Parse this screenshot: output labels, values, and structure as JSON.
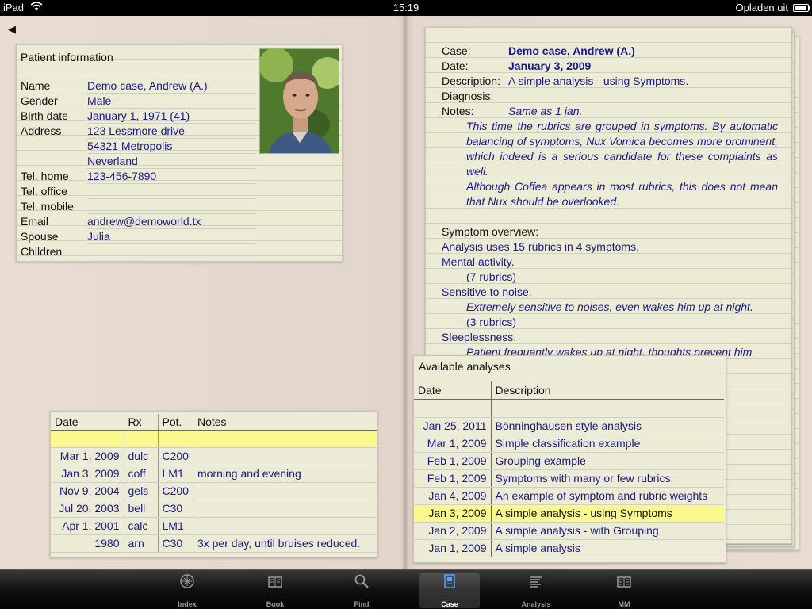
{
  "status": {
    "device": "iPad",
    "time": "15:19",
    "battery_text": "Opladen uit"
  },
  "patient": {
    "heading": "Patient information",
    "fields": [
      {
        "label": "Name",
        "value": "Demo case, Andrew (A.)"
      },
      {
        "label": "Gender",
        "value": "Male"
      },
      {
        "label": "Birth date",
        "value": "January 1, 1971 (41)"
      },
      {
        "label": "Address",
        "value": "123 Lessmore drive"
      },
      {
        "label": "",
        "value": "54321  Metropolis"
      },
      {
        "label": "",
        "value": "Neverland"
      },
      {
        "label": "Tel. home",
        "value": "123-456-7890"
      },
      {
        "label": "Tel. office",
        "value": ""
      },
      {
        "label": "Tel. mobile",
        "value": ""
      },
      {
        "label": "Email",
        "value": "andrew@demoworld.tx"
      },
      {
        "label": "Spouse",
        "value": "Julia"
      },
      {
        "label": "Children",
        "value": ""
      }
    ]
  },
  "prescriptions": {
    "headers": [
      "Date",
      "Rx",
      "Pot.",
      "Notes"
    ],
    "rows": [
      {
        "date": "Mar 1, 2009",
        "rx": "dulc",
        "pot": "C200",
        "notes": ""
      },
      {
        "date": "Jan 3, 2009",
        "rx": "coff",
        "pot": "LM1",
        "notes": "morning and evening"
      },
      {
        "date": "Nov 9, 2004",
        "rx": "gels",
        "pot": "C200",
        "notes": ""
      },
      {
        "date": "Jul 20, 2003",
        "rx": "bell",
        "pot": "C30",
        "notes": ""
      },
      {
        "date": "Apr 1, 2001",
        "rx": "calc",
        "pot": "LM1",
        "notes": ""
      },
      {
        "date": "1980",
        "rx": "arn",
        "pot": "C30",
        "notes": "3x per day, until bruises reduced."
      }
    ]
  },
  "case": {
    "case_label": "Case:",
    "case_value": "Demo case, Andrew (A.)",
    "date_label": "Date:",
    "date_value": "January 3, 2009",
    "desc_label": "Description:",
    "desc_value": "A simple analysis - using Symptoms.",
    "diag_label": "Diagnosis:",
    "notes_label": "Notes:",
    "notes_first": "Same as 1 jan.",
    "notes_para1": "This time the rubrics are grouped in symptoms. By automatic balancing of symptoms, Nux Vomica becomes more prominent, which indeed is a serious candidate for these complaints as well.",
    "notes_para2": "Although Coffea appears in most rubrics, this does not mean that Nux should be overlooked.",
    "overview_label": "Symptom overview:",
    "overview_summary": "Analysis uses 15 rubrics in 4 symptoms.",
    "s1": "Mental activity.",
    "s1_count": "(7 rubrics)",
    "s2": "Sensitive to noise.",
    "s2_note": "Extremely sensitive to noises, even wakes him up at night.",
    "s2_count": "(3 rubrics)",
    "s3": "Sleeplessness.",
    "s3_note": "Patient frequently wakes up at night, thoughts prevent him"
  },
  "analyses": {
    "title": "Available analyses",
    "headers": [
      "Date",
      "Description"
    ],
    "rows": [
      {
        "date": "Jan 25, 2011",
        "desc": "Bönninghausen style analysis"
      },
      {
        "date": "Mar 1, 2009",
        "desc": "Simple classification example"
      },
      {
        "date": "Feb 1, 2009",
        "desc": "Grouping example"
      },
      {
        "date": "Feb 1, 2009",
        "desc": "Symptoms with many or few rubrics."
      },
      {
        "date": "Jan 4, 2009",
        "desc": "An example of symptom and rubric weights"
      },
      {
        "date": "Jan 3, 2009",
        "desc": "A simple analysis - using Symptoms"
      },
      {
        "date": "Jan 2, 2009",
        "desc": "A simple analysis - with Grouping"
      },
      {
        "date": "Jan 1, 2009",
        "desc": "A simple analysis"
      }
    ]
  },
  "tabs": [
    {
      "label": "Index",
      "icon": "index-icon"
    },
    {
      "label": "Book",
      "icon": "book-icon"
    },
    {
      "label": "Find",
      "icon": "magnifier-icon"
    },
    {
      "label": "Case",
      "icon": "case-icon"
    },
    {
      "label": "Analysis",
      "icon": "analysis-icon"
    },
    {
      "label": "MM",
      "icon": "materia-medica-icon"
    }
  ]
}
